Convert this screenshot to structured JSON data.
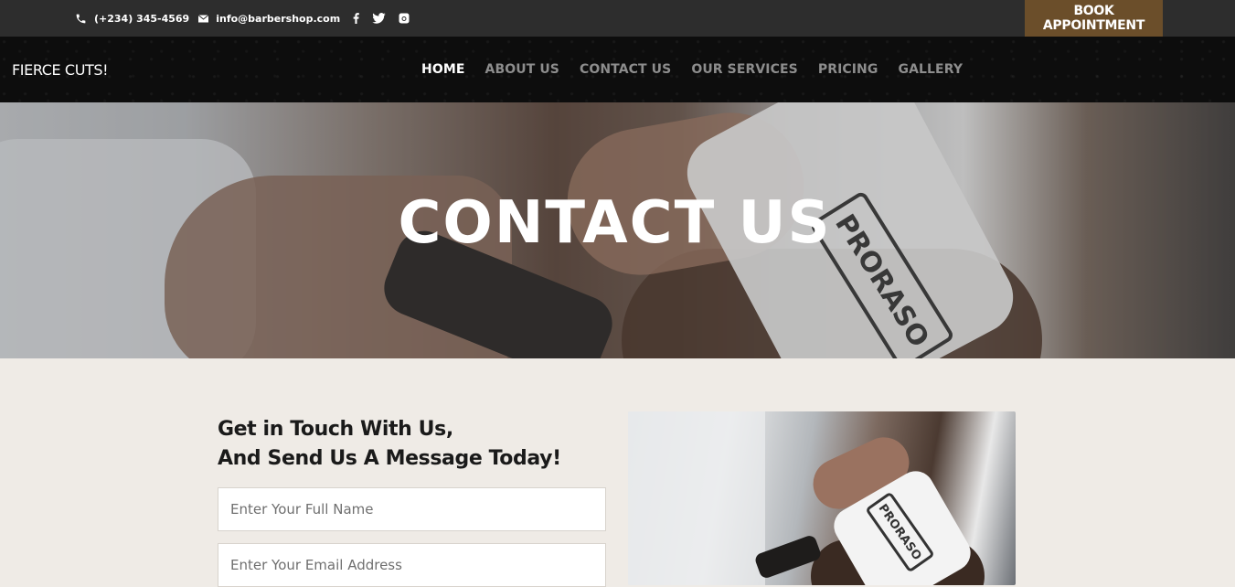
{
  "topbar": {
    "phone": "(+234) 345-4569",
    "email": "info@barbershop.com",
    "social": [
      "facebook-icon",
      "twitter-icon",
      "instagram-icon"
    ],
    "book_label": "BOOK APPOINTMENT"
  },
  "navbar": {
    "logo": "FIERCE CUTS!",
    "items": [
      {
        "label": "HOME",
        "active": true
      },
      {
        "label": "ABOUT US",
        "active": false
      },
      {
        "label": "CONTACT US",
        "active": false
      },
      {
        "label": "OUR SERVICES",
        "active": false
      },
      {
        "label": "PRICING",
        "active": false
      },
      {
        "label": "GALLERY",
        "active": false
      }
    ]
  },
  "hero": {
    "title": "CONTACT US",
    "photo_text": "PRORASO"
  },
  "contact": {
    "heading_line1": "Get in Touch With Us,",
    "heading_line2": "And Send Us A Message Today!",
    "name_placeholder": "Enter Your Full Name",
    "email_placeholder": "Enter Your Email Address",
    "photo_text": "PRORASO"
  },
  "colors": {
    "topbar": "#2d2d2d",
    "accent": "#6b4e2a",
    "nav_bg": "#0d0d0d",
    "content_bg": "#efebe6"
  }
}
